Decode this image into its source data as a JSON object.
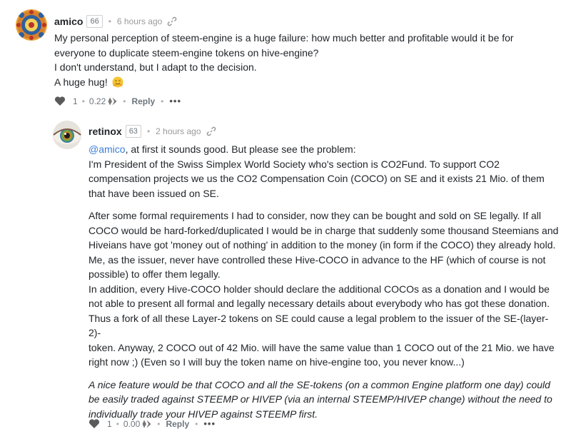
{
  "comments": [
    {
      "author": "amico",
      "reputation": "66",
      "time": "6 hours ago",
      "lines": [
        "My personal perception of steem-engine is a huge failure: how much better and profitable would it be for",
        "everyone to duplicate steem-engine tokens on hive-engine?",
        "I don't understand, but I adapt to the decision.",
        "A huge hug!"
      ],
      "votes": "1",
      "payout": "0.22",
      "reply_label": "Reply",
      "more_label": "•••"
    },
    {
      "author": "retinox",
      "reputation": "63",
      "time": "2 hours ago",
      "mention": "@amico",
      "para1_first_rest": ", at first it sounds good. But please see the problem:",
      "para1_lines": [
        "I'm President of the Swiss Simplex World Society who's section is CO2Fund. To support CO2",
        "compensation projects we us the CO2 Compensation Coin (COCO) on SE and it exists 21 Mio. of them",
        "that have been issued on SE."
      ],
      "para2_lines": [
        "After some formal requirements I had to consider, now they can be bought and sold on SE legally. If all",
        "COCO would be hard-forked/duplicated I would be in charge that suddenly some thousand Steemians and",
        "Hiveians have got 'money out of nothing' in addition to the money (in form if the COCO) they already hold.",
        "Me, as the issuer, never have controlled these Hive-COCO in advance to the HF (which of course is not",
        "possible) to offer them legally.",
        "In addition, every Hive-COCO holder should declare the additional COCOs as a donation and I would be",
        "not able to present all formal and legally necessary details about everybody who has got these donation.",
        "Thus a fork of all these Layer-2 tokens on SE could cause a legal problem to the issuer of the SE-(layer-2)-",
        "token. Anyway, 2 COCO out of 42 Mio. will have the same value than 1 COCO out of the 21 Mio. we have",
        "right now ;) (Even so I will buy the token name on hive-engine too, you never know...)"
      ],
      "para3_lines": [
        "A nice feature would be that COCO and all the SE-tokens (on a common Engine platform one day) could",
        "be easily traded against STEEMP or HIVEP (via an internal STEEMP/HIVEP change) without the need to",
        "individually trade your HIVEP against STEEMP first."
      ],
      "votes": "1",
      "payout": "0.00",
      "reply_label": "Reply",
      "more_label": "•••"
    }
  ]
}
